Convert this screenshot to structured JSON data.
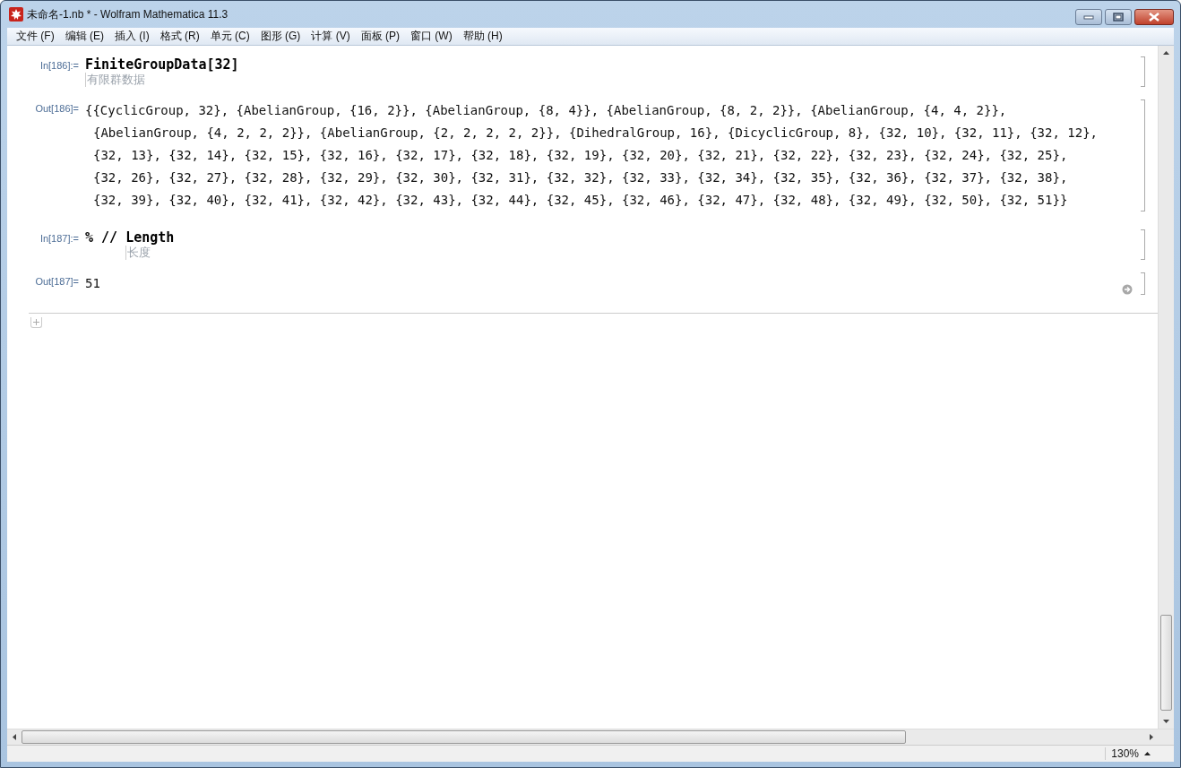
{
  "window": {
    "title": "未命名-1.nb * - Wolfram Mathematica 11.3"
  },
  "menu": [
    "文件 (F)",
    "编辑 (E)",
    "插入 (I)",
    "格式 (R)",
    "单元 (C)",
    "图形 (G)",
    "计算 (V)",
    "面板 (P)",
    "窗口 (W)",
    "帮助 (H)"
  ],
  "cells": [
    {
      "kind": "input",
      "label": "In[186]:=",
      "code": "FiniteGroupData[32]",
      "hint": "有限群数据"
    },
    {
      "kind": "output",
      "label": "Out[186]=",
      "lines": [
        "{{CyclicGroup, 32}, {AbelianGroup, {16, 2}}, {AbelianGroup, {8, 4}}, {AbelianGroup, {8, 2, 2}}, {AbelianGroup, {4, 4, 2}},",
        "{AbelianGroup, {4, 2, 2, 2}}, {AbelianGroup, {2, 2, 2, 2, 2}}, {DihedralGroup, 16}, {DicyclicGroup, 8}, {32, 10}, {32, 11}, {32, 12},",
        "{32, 13}, {32, 14}, {32, 15}, {32, 16}, {32, 17}, {32, 18}, {32, 19}, {32, 20}, {32, 21}, {32, 22}, {32, 23}, {32, 24}, {32, 25},",
        "{32, 26}, {32, 27}, {32, 28}, {32, 29}, {32, 30}, {32, 31}, {32, 32}, {32, 33}, {32, 34}, {32, 35}, {32, 36}, {32, 37}, {32, 38},",
        "{32, 39}, {32, 40}, {32, 41}, {32, 42}, {32, 43}, {32, 44}, {32, 45}, {32, 46}, {32, 47}, {32, 48}, {32, 49}, {32, 50}, {32, 51}}"
      ]
    },
    {
      "kind": "input",
      "label": "In[187]:=",
      "prefix": "% // ",
      "code": "Length",
      "hint": "长度"
    },
    {
      "kind": "output",
      "label": "Out[187]=",
      "lines": [
        "51"
      ],
      "suggest": true
    }
  ],
  "status_bar": {
    "zoom": "130%"
  }
}
